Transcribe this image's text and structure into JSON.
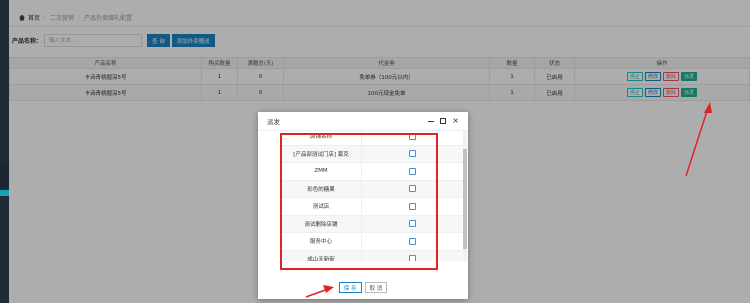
{
  "breadcrumb": {
    "home": "首页",
    "level1": "二次营销",
    "level2": "产品外卖赠礼配置"
  },
  "search": {
    "label": "产品名称：",
    "placeholder": "输入文本...",
    "search_button": "查 询",
    "add_button": "添加外卖赠送"
  },
  "table": {
    "headers": [
      "产品名称",
      "购买数量",
      "满赠总(天)",
      "代金券",
      "数量",
      "状态",
      "操作"
    ],
    "rows": [
      {
        "name": "卡诗青桃掘深5号",
        "qty": "1",
        "days": "0",
        "coupon": "免单券（100元以内）",
        "count": "1",
        "status": "已启用"
      },
      {
        "name": "卡诗青桃掘深5号",
        "qty": "1",
        "days": "0",
        "coupon": "100元现金免单",
        "count": "1",
        "status": "已启用"
      }
    ],
    "actions": {
      "stop": "停止",
      "edit": "修改",
      "delete": "删除",
      "dispatch": "派发"
    }
  },
  "modal": {
    "title": "派发",
    "shops": [
      {
        "name": "店铺名称",
        "checked": false
      },
      {
        "name": "[产品部测试门店] 慕克",
        "checked": false
      },
      {
        "name": "ZMM",
        "checked": false
      },
      {
        "name": "彩色的糖果",
        "checked": false
      },
      {
        "name": "测试店",
        "checked": false
      },
      {
        "name": "测试删除店铺",
        "checked": false
      },
      {
        "name": "服务中心",
        "checked": false
      },
      {
        "name": "成山天新街",
        "checked": false
      }
    ],
    "save_button": "保 存",
    "cancel_button": "取 消"
  },
  "colors": {
    "highlight_frame": "#e02424",
    "annotation_arrow": "#e02424",
    "primary": "#1c84c6",
    "dispatch": "#1ab394",
    "danger": "#ed5565"
  }
}
